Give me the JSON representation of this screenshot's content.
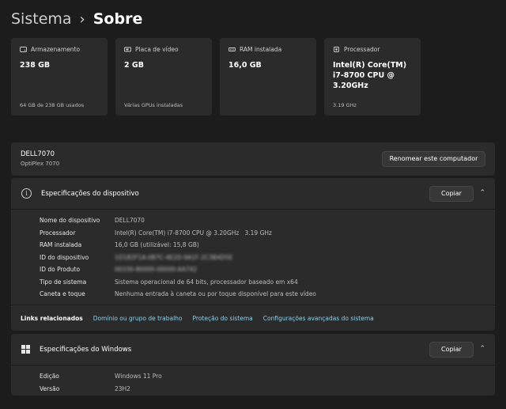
{
  "breadcrumb": {
    "parent": "Sistema",
    "separator": "›",
    "current": "Sobre"
  },
  "cards": [
    {
      "icon": "storage-icon",
      "title": "Armazenamento",
      "value": "238 GB",
      "sub": "64 GB de 238 GB usados"
    },
    {
      "icon": "gpu-icon",
      "title": "Placa de vídeo",
      "value": "2 GB",
      "sub": "Várias GPUs instaladas"
    },
    {
      "icon": "ram-icon",
      "title": "RAM instalada",
      "value": "16,0 GB",
      "sub": ""
    },
    {
      "icon": "processor-icon",
      "title": "Processador",
      "value": "Intel(R) Core(TM) i7-8700 CPU @ 3.20GHz",
      "sub": "3.19 GHz"
    }
  ],
  "computer": {
    "name": "DELL7070",
    "model": "OptiPlex 7070",
    "rename_label": "Renomear este computador"
  },
  "device_specs": {
    "title": "Especificações do dispositivo",
    "copy_label": "Copiar",
    "rows": [
      {
        "label": "Nome do dispositivo",
        "value": "DELL7070"
      },
      {
        "label": "Processador",
        "value": "Intel(R) Core(TM) i7-8700 CPU @ 3.20GHz   3.19 GHz"
      },
      {
        "label": "RAM instalada",
        "value": "16,0 GB (utilizável: 15,8 GB)"
      },
      {
        "label": "ID do dispositivo",
        "value": "1D1B2F1A-0B7C-4E2D-9A1F-2C3B4D5E"
      },
      {
        "label": "ID do Produto",
        "value": "00330-80000-00000-AA742"
      },
      {
        "label": "Tipo de sistema",
        "value": "Sistema operacional de 64 bits, processador baseado em x64"
      },
      {
        "label": "Caneta e toque",
        "value": "Nenhuma entrada à caneta ou por toque disponível para este vídeo"
      }
    ],
    "links_label": "Links relacionados",
    "links": [
      "Domínio ou grupo de trabalho",
      "Proteção do sistema",
      "Configurações avançadas do sistema"
    ]
  },
  "windows_specs": {
    "title": "Especificações do Windows",
    "copy_label": "Copiar",
    "rows": [
      {
        "label": "Edição",
        "value": "Windows 11 Pro"
      },
      {
        "label": "Versão",
        "value": "23H2"
      }
    ]
  }
}
